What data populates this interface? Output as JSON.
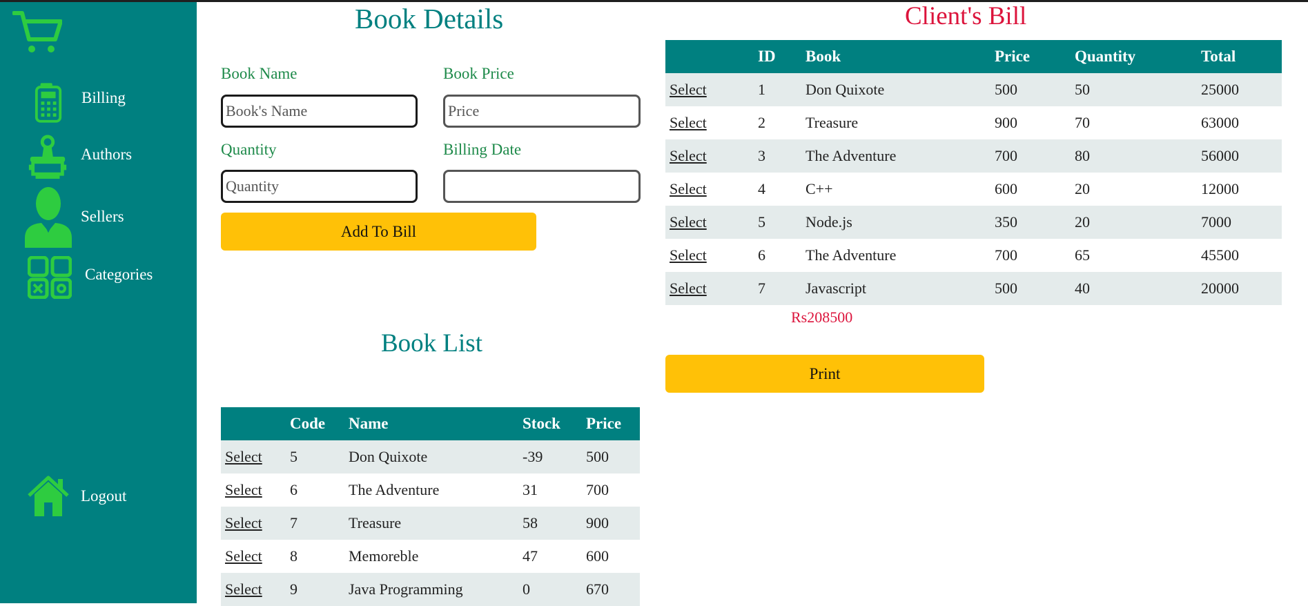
{
  "sidebar": {
    "items": [
      {
        "label": "Billing",
        "icon": "calculator-icon"
      },
      {
        "label": "Authors",
        "icon": "author-stamp-icon"
      },
      {
        "label": "Sellers",
        "icon": "person-icon"
      },
      {
        "label": "Categories",
        "icon": "categories-grid-icon"
      },
      {
        "label": "Logout",
        "icon": "home-icon"
      }
    ],
    "logo_icon": "cart-icon"
  },
  "book_details": {
    "title": "Book Details",
    "book_name_label": "Book Name",
    "book_name_placeholder": "Book's Name",
    "book_price_label": "Book Price",
    "book_price_placeholder": "Price",
    "quantity_label": "Quantity",
    "quantity_placeholder": "Quantity",
    "billing_date_label": "Billing Date",
    "billing_date_value": "",
    "add_button": "Add To Bill"
  },
  "book_list": {
    "title": "Book List",
    "columns": [
      "",
      "Code",
      "Name",
      "Stock",
      "Price"
    ],
    "rows": [
      {
        "action": "Select",
        "code": "5",
        "name": "Don Quixote",
        "stock": "-39",
        "price": "500"
      },
      {
        "action": "Select",
        "code": "6",
        "name": "The Adventure",
        "stock": "31",
        "price": "700"
      },
      {
        "action": "Select",
        "code": "7",
        "name": "Treasure",
        "stock": "58",
        "price": "900"
      },
      {
        "action": "Select",
        "code": "8",
        "name": "Memoreble",
        "stock": "47",
        "price": "600"
      },
      {
        "action": "Select",
        "code": "9",
        "name": "Java Programming",
        "stock": "0",
        "price": "670"
      }
    ]
  },
  "client_bill": {
    "title": "Client's Bill",
    "columns": [
      "",
      "ID",
      "Book",
      "Price",
      "Quantity",
      "Total"
    ],
    "rows": [
      {
        "action": "Select",
        "id": "1",
        "book": "Don Quixote",
        "price": "500",
        "quantity": "50",
        "total": "25000"
      },
      {
        "action": "Select",
        "id": "2",
        "book": "Treasure",
        "price": "900",
        "quantity": "70",
        "total": "63000"
      },
      {
        "action": "Select",
        "id": "3",
        "book": "The Adventure",
        "price": "700",
        "quantity": "80",
        "total": "56000"
      },
      {
        "action": "Select",
        "id": "4",
        "book": "C++",
        "price": "600",
        "quantity": "20",
        "total": "12000"
      },
      {
        "action": "Select",
        "id": "5",
        "book": "Node.js",
        "price": "350",
        "quantity": "20",
        "total": "7000"
      },
      {
        "action": "Select",
        "id": "6",
        "book": "The Adventure",
        "price": "700",
        "quantity": "65",
        "total": "45500"
      },
      {
        "action": "Select",
        "id": "7",
        "book": "Javascript",
        "price": "500",
        "quantity": "40",
        "total": "20000"
      }
    ],
    "grand_total": "Rs208500",
    "print_button": "Print"
  },
  "colors": {
    "sidebar": "#008080",
    "icon_green": "#2ECC40",
    "heading_teal": "#008080",
    "heading_red": "#DC143C",
    "label_green": "#1e8a4a",
    "button_yellow": "#FFC107",
    "row_shade": "#e4ebeb"
  }
}
